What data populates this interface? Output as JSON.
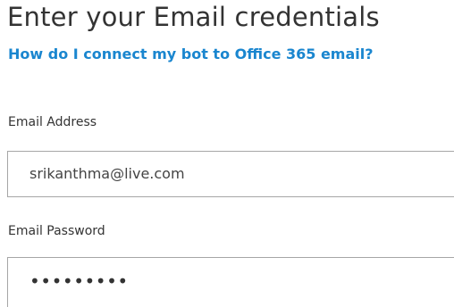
{
  "header": {
    "title": "Enter your Email credentials",
    "help_link": "How do I connect my bot to Office 365 email?"
  },
  "form": {
    "email": {
      "label": "Email Address",
      "value": "srikanthma@live.com"
    },
    "password": {
      "label": "Email Password",
      "masked_value": "•••••••••"
    }
  },
  "colors": {
    "link": "#1a86cf",
    "text": "#333333",
    "border": "#a6a6a6"
  }
}
